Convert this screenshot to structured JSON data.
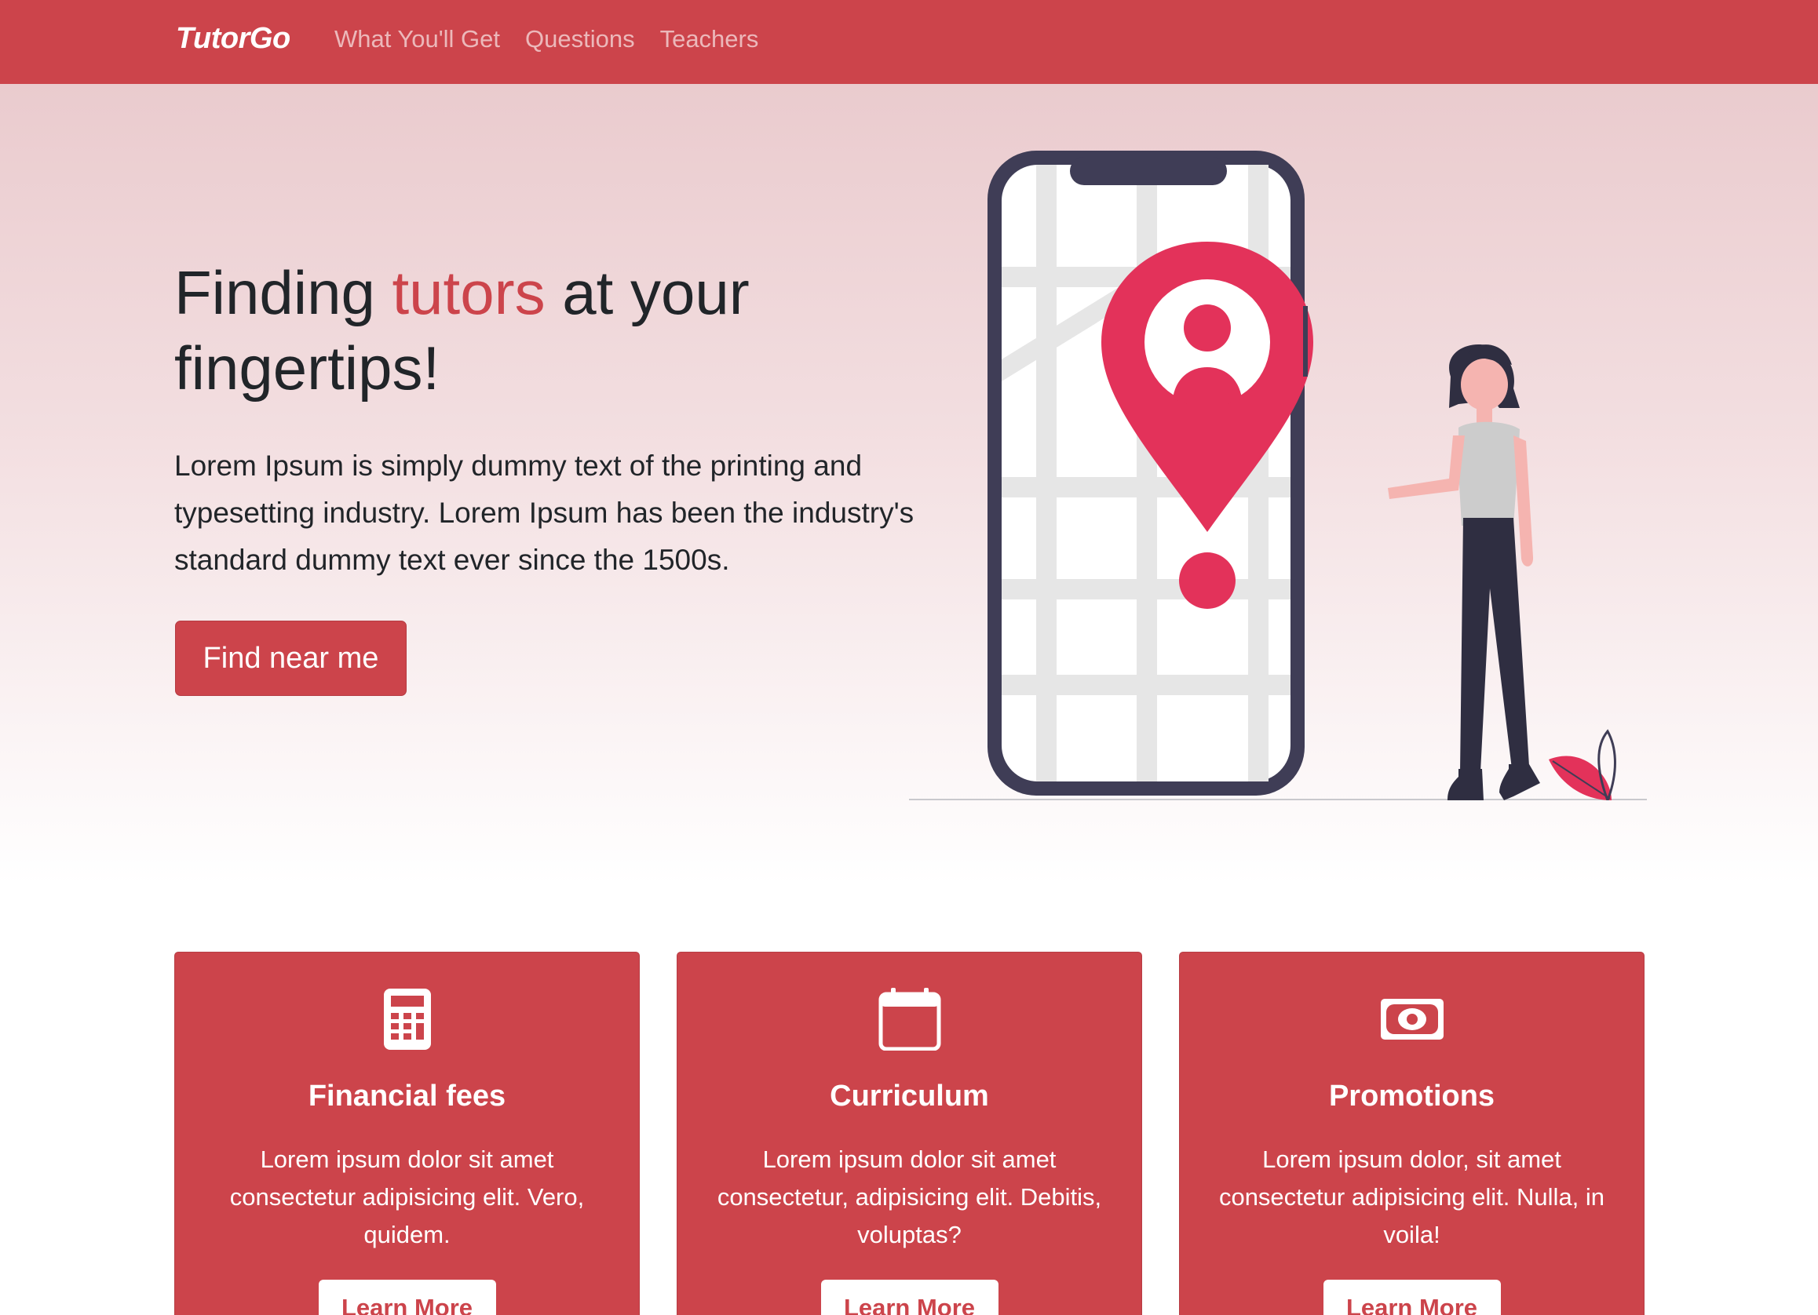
{
  "nav": {
    "brand": "TutorGo",
    "links": [
      "What You'll Get",
      "Questions",
      "Teachers"
    ]
  },
  "hero": {
    "title_part1": "Finding ",
    "title_accent": "tutors",
    "title_part2": " at your fingertips!",
    "text": "Lorem Ipsum is simply dummy text of the printing and typesetting industry. Lorem Ipsum has been the industry's standard dummy text ever since the 1500s.",
    "button_label": "Find near me"
  },
  "cards": [
    {
      "icon": "calculator-icon",
      "title": "Financial fees",
      "text": "Lorem ipsum dolor sit amet consectetur adipisicing elit. Vero, quidem.",
      "button_label": "Learn More"
    },
    {
      "icon": "calendar-icon",
      "title": "Curriculum",
      "text": "Lorem ipsum dolor sit amet consectetur, adipisicing elit. Debitis, voluptas?",
      "button_label": "Learn More"
    },
    {
      "icon": "cash-icon",
      "title": "Promotions",
      "text": "Lorem ipsum dolor, sit amet consectetur adipisicing elit. Nulla, in voila!",
      "button_label": "Learn More"
    }
  ],
  "colors": {
    "brand": "#cc444b",
    "pin": "#e3325a",
    "dark": "#3f3d56"
  }
}
